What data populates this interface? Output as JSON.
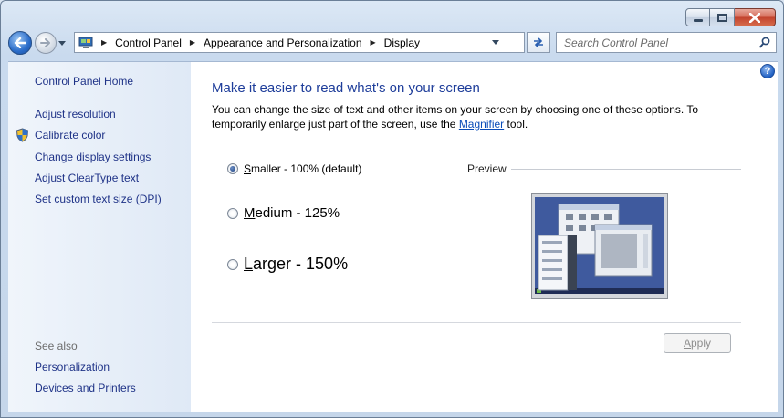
{
  "navigation": {
    "breadcrumbs": [
      "Control Panel",
      "Appearance and Personalization",
      "Display"
    ],
    "search_placeholder": "Search Control Panel"
  },
  "sidebar": {
    "home": "Control Panel Home",
    "links": [
      "Adjust resolution",
      "Calibrate color",
      "Change display settings",
      "Adjust ClearType text",
      "Set custom text size (DPI)"
    ],
    "see_also_heading": "See also",
    "see_also": [
      "Personalization",
      "Devices and Printers"
    ]
  },
  "main": {
    "help_glyph": "?",
    "heading": "Make it easier to read what's on your screen",
    "description_before_link": "You can change the size of text and other items on your screen by choosing one of these options. To temporarily enlarge just part of the screen, use the ",
    "description_link": "Magnifier",
    "description_after_link": " tool.",
    "options": [
      {
        "accel": "S",
        "rest": "maller - 100% (default)",
        "checked": true
      },
      {
        "accel": "M",
        "rest": "edium - 125%",
        "checked": false
      },
      {
        "accel": "L",
        "rest": "arger - 150%",
        "checked": false
      }
    ],
    "preview_label": "Preview",
    "apply": {
      "accel": "A",
      "rest": "pply"
    }
  },
  "colors": {
    "link": "#1e3287",
    "heading": "#1e3d9a",
    "sidebar_bg": "#e6eef8"
  },
  "icons": [
    "back-arrow-icon",
    "forward-arrow-icon",
    "control-panel-icon",
    "refresh-icon",
    "search-icon",
    "shield-icon",
    "help-icon",
    "minimize-icon",
    "maximize-icon",
    "close-icon"
  ]
}
